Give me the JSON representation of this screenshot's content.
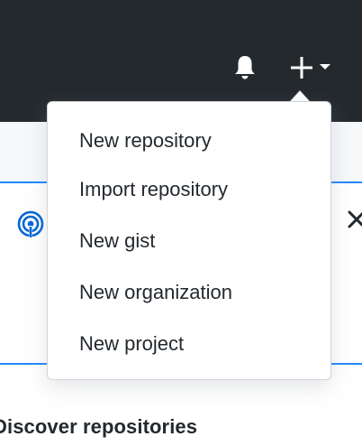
{
  "header": {
    "notifications_icon": "bell-icon",
    "create_icon": "plus-icon",
    "create_caret_icon": "caret-down-icon",
    "background_color": "#24292e"
  },
  "create_menu": {
    "items": [
      {
        "label": "New repository"
      },
      {
        "label": "Import repository"
      },
      {
        "label": "New gist"
      },
      {
        "label": "New organization"
      },
      {
        "label": "New project"
      }
    ]
  },
  "promo_card": {
    "icon": "broadcast-icon",
    "close_icon": "close-icon",
    "accent_color": "#2188ff"
  },
  "discover": {
    "title": "Discover repositories"
  }
}
